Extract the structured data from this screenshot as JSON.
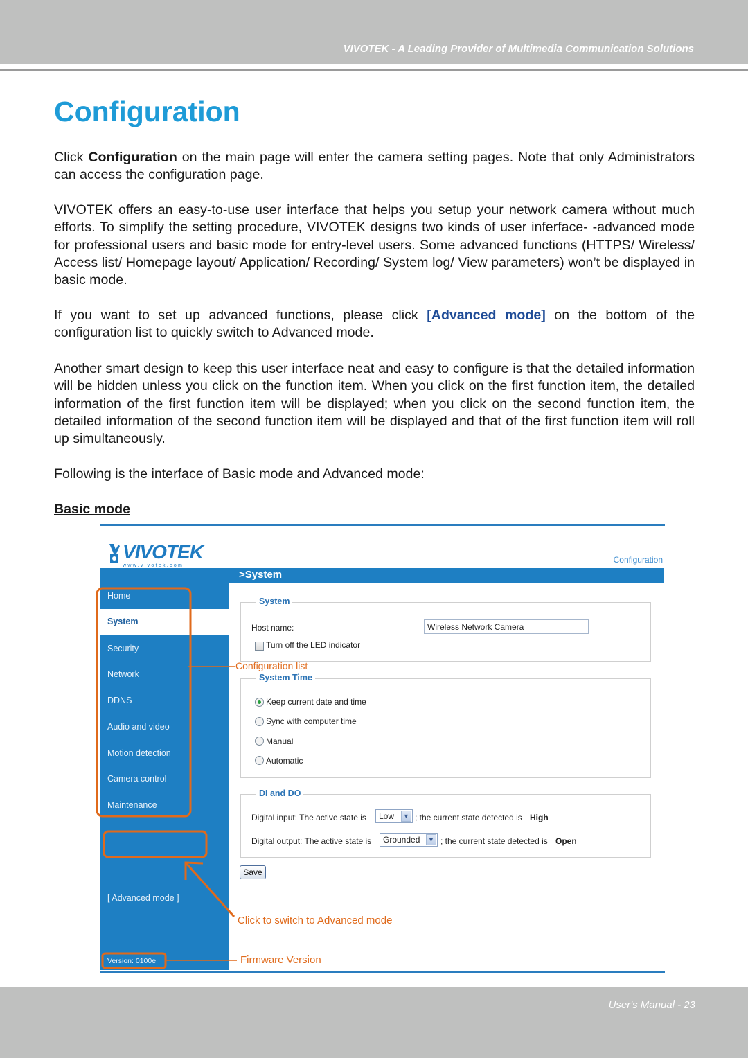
{
  "header": {
    "tagline": "VIVOTEK - A Leading Provider of Multimedia Communication Solutions"
  },
  "title": "Configuration",
  "paragraphs": {
    "p1_pre": "Click ",
    "p1_bold": "Configuration",
    "p1_post": " on the main page will enter the camera setting pages. Note that only Administrators can access the configuration page.",
    "p2": "VIVOTEK offers an easy-to-use user interface that helps you setup your network camera without much efforts. To simplify the setting procedure, VIVOTEK designs two kinds of user inferface- -advanced mode for professional users and basic mode for entry-level users. Some advanced functions (HTTPS/ Wireless/ Access list/ Homepage layout/ Application/ Recording/ System log/ View parameters) won’t be displayed in basic mode.",
    "p3_pre": "If you want to set up advanced functions, please click ",
    "p3_link": "[Advanced mode]",
    "p3_post": " on the bottom of the configuration list to quickly switch to Advanced mode.",
    "p4": "Another smart design to keep this user interface neat and easy to configure is that the detailed information will be hidden unless you click on the function item. When you click on the first function item, the detailed information of the first function item will be displayed; when you click on the second function item, the detailed information of the second function item will be displayed and that of the first function item will roll up simultaneously.",
    "p5": "Following is the interface of Basic mode and Advanced mode:"
  },
  "section_heading": "Basic mode",
  "screenshot": {
    "logo_text": "VIVOTEK",
    "logo_url_text": "www.vivotek.com",
    "top_link": "Configuration",
    "section_bar": ">System",
    "sidebar": {
      "items": [
        {
          "label": "Home",
          "active": false
        },
        {
          "label": "System",
          "active": true
        },
        {
          "label": "Security",
          "active": false
        },
        {
          "label": "Network",
          "active": false
        },
        {
          "label": "DDNS",
          "active": false
        },
        {
          "label": "Audio and video",
          "active": false
        },
        {
          "label": "Motion detection",
          "active": false
        },
        {
          "label": "Camera control",
          "active": false
        },
        {
          "label": "Maintenance",
          "active": false
        }
      ],
      "advanced_mode": "[ Advanced mode ]",
      "version": "Version: 0100e"
    },
    "system_box": {
      "legend": "System",
      "host_label": "Host name:",
      "host_value": "Wireless Network Camera",
      "led_label": "Turn off the LED indicator",
      "led_checked": false
    },
    "time_box": {
      "legend": "System Time",
      "options": [
        {
          "label": "Keep current date and time",
          "selected": true
        },
        {
          "label": "Sync with computer time",
          "selected": false
        },
        {
          "label": "Manual",
          "selected": false
        },
        {
          "label": "Automatic",
          "selected": false
        }
      ]
    },
    "dido_box": {
      "legend": "DI and DO",
      "di_pre": "Digital input: The active state is",
      "di_value": "Low",
      "di_post": "; the current state detected is",
      "di_state": "High",
      "do_pre": "Digital output: The active state is",
      "do_value": "Grounded",
      "do_post": "; the current state detected is",
      "do_state": "Open"
    },
    "save_label": "Save",
    "annotations": {
      "config_list": "Configuration list",
      "switch_adv": "Click to switch to Advanced mode",
      "firmware": "Firmware Version"
    },
    "annotation_color": "#e06a1b",
    "brand_blue": "#1e7fc3"
  },
  "footer": {
    "page_label": "User's Manual - 23"
  }
}
